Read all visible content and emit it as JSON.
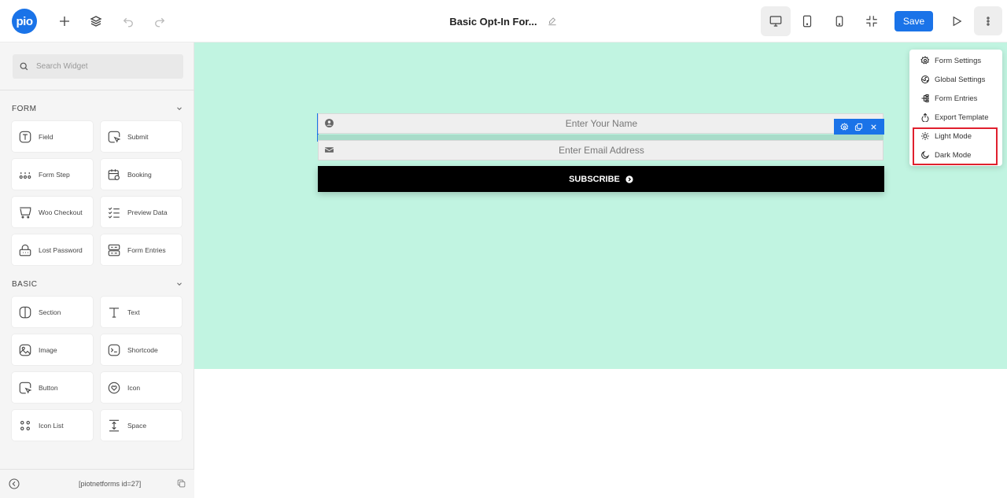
{
  "header": {
    "title": "Basic Opt-In For...",
    "save_label": "Save",
    "logo_text": "pio",
    "icons": [
      "plus-icon",
      "layers-icon",
      "undo-icon",
      "redo-icon",
      "edit-icon",
      "desktop-icon",
      "tablet-icon",
      "mobile-icon",
      "collapse-icon",
      "preview-play-icon",
      "more-vertical-icon"
    ]
  },
  "sidebar": {
    "search_placeholder": "Search Widget",
    "sections": [
      {
        "title": "FORM",
        "widgets": [
          {
            "label": "Field",
            "icon": "text-field-icon"
          },
          {
            "label": "Submit",
            "icon": "submit-icon"
          },
          {
            "label": "Form Step",
            "icon": "form-step-icon"
          },
          {
            "label": "Booking",
            "icon": "calendar-icon"
          },
          {
            "label": "Woo Checkout",
            "icon": "cart-icon"
          },
          {
            "label": "Preview Data",
            "icon": "checklist-icon"
          },
          {
            "label": "Lost Password",
            "icon": "lock-icon"
          },
          {
            "label": "Form Entries",
            "icon": "entries-icon"
          }
        ]
      },
      {
        "title": "BASIC",
        "widgets": [
          {
            "label": "Section",
            "icon": "section-icon"
          },
          {
            "label": "Text",
            "icon": "text-icon"
          },
          {
            "label": "Image",
            "icon": "image-icon"
          },
          {
            "label": "Shortcode",
            "icon": "shortcode-icon"
          },
          {
            "label": "Button",
            "icon": "button-icon"
          },
          {
            "label": "Icon",
            "icon": "heart-icon"
          },
          {
            "label": "Icon List",
            "icon": "icon-list-icon"
          },
          {
            "label": "Space",
            "icon": "space-icon"
          }
        ]
      }
    ],
    "footer_shortcode": "[piotnetforms id=27]"
  },
  "canvas": {
    "name_placeholder": "Enter Your Name",
    "email_placeholder": "Enter Email Address",
    "subscribe_label": "SUBSCRIBE",
    "background_color": "#c1f4e1"
  },
  "menu": {
    "items": [
      {
        "label": "Form Settings",
        "icon": "gear-icon"
      },
      {
        "label": "Global Settings",
        "icon": "globe-icon"
      },
      {
        "label": "Form Entries",
        "icon": "entries-tree-icon"
      },
      {
        "label": "Export Template",
        "icon": "export-icon"
      },
      {
        "label": "Light Mode",
        "icon": "sun-icon"
      },
      {
        "label": "Dark Mode",
        "icon": "moon-icon"
      }
    ]
  },
  "colors": {
    "accent": "#1a73e8",
    "highlight": "#e0202e"
  }
}
